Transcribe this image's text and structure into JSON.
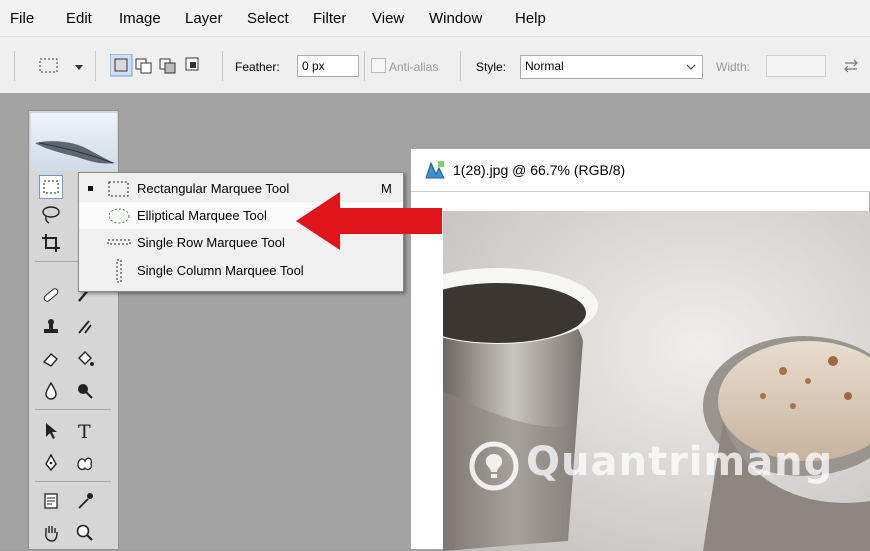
{
  "menu": [
    "File",
    "Edit",
    "Image",
    "Layer",
    "Select",
    "Filter",
    "View",
    "Window",
    "Help"
  ],
  "options": {
    "feather_label": "Feather:",
    "feather_value": "0 px",
    "antialias_label": "Anti-alias",
    "style_label": "Style:",
    "style_value": "Normal",
    "width_label": "Width:"
  },
  "flyout": {
    "items": [
      {
        "label": "Rectangular Marquee Tool",
        "shortcut": "M",
        "icon": "rect-marquee-icon",
        "selected": true
      },
      {
        "label": "Elliptical Marquee Tool",
        "icon": "ellipse-marquee-icon",
        "highlighted": true
      },
      {
        "label": "Single Row Marquee Tool",
        "icon": "single-row-marquee-icon"
      },
      {
        "label": "Single Column Marquee Tool",
        "icon": "single-column-marquee-icon"
      }
    ]
  },
  "document": {
    "title": "1(28).jpg @ 66.7% (RGB/8)"
  },
  "watermark": "Quantrimang",
  "colors": {
    "arrow": "#e0141b",
    "highlight_border": "#6c9bd1"
  }
}
